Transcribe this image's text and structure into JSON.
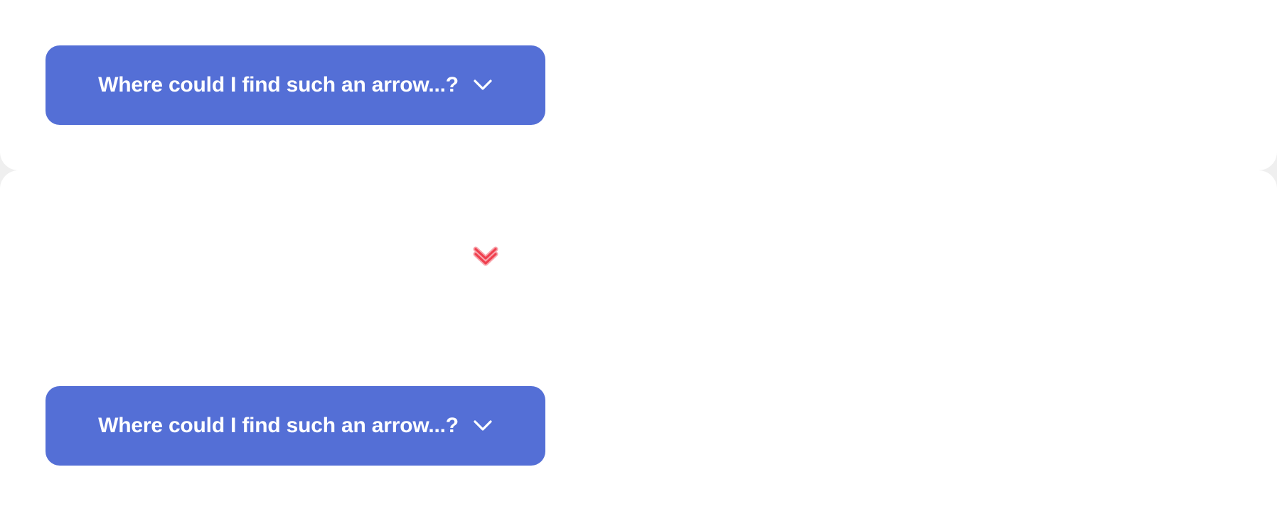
{
  "buttons": {
    "top": {
      "label": "Where could I find such an arrow...?",
      "icon": "chevron-down-icon"
    },
    "bottom": {
      "label": "Where could I find such an arrow...?",
      "icon": "chevron-down-icon"
    }
  },
  "showcase_icon": {
    "icon": "double-chevron-down-icon",
    "color": "#f0404f"
  },
  "colors": {
    "button_bg": "#546fd6",
    "button_text": "#ffffff",
    "panel_bg": "#ffffff",
    "page_bg": "#efefef"
  }
}
